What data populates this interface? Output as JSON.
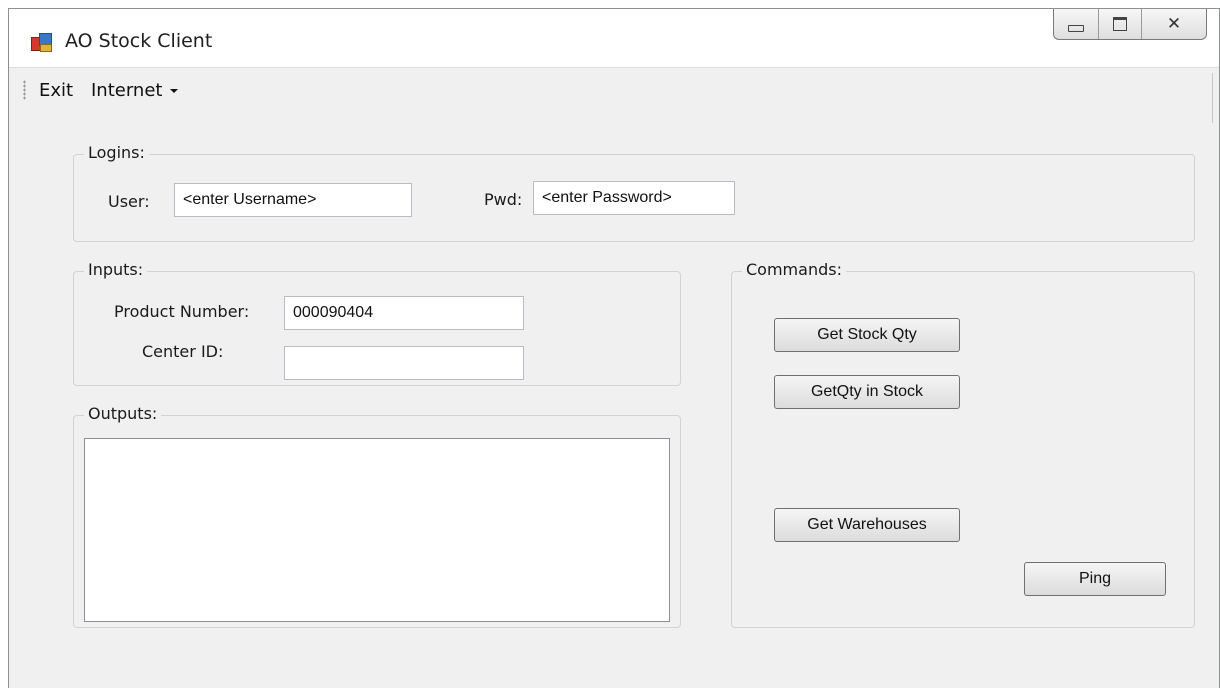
{
  "window": {
    "title": "AO Stock Client"
  },
  "menu": {
    "exit": "Exit",
    "internet": "Internet"
  },
  "logins": {
    "legend": "Logins:",
    "user_label": "User:",
    "user_value": "<enter Username>",
    "pwd_label": "Pwd:",
    "pwd_value": "<enter Password>"
  },
  "inputs": {
    "legend": "Inputs:",
    "product_label": "Product Number:",
    "product_value": "000090404",
    "center_label": "Center ID:",
    "center_value": ""
  },
  "outputs": {
    "legend": "Outputs:",
    "value": ""
  },
  "commands": {
    "legend": "Commands:",
    "get_stock_qty": "Get Stock Qty",
    "get_qty_in_stock": "GetQty in Stock",
    "get_warehouses": "Get Warehouses",
    "ping": "Ping"
  }
}
